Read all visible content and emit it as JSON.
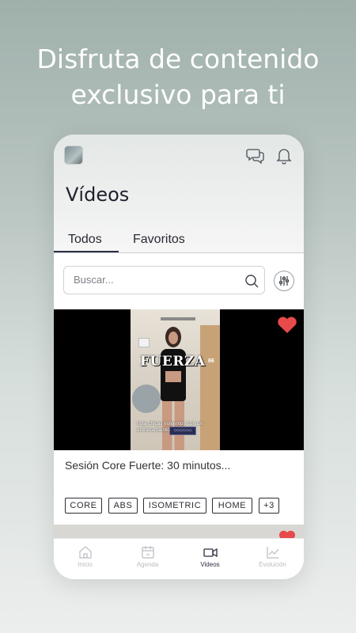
{
  "headline": {
    "line1": "Disfruta de contenido",
    "line2": "exclusivo para ti"
  },
  "screen": {
    "title": "Vídeos",
    "tabs": [
      {
        "label": "Todos",
        "active": true
      },
      {
        "label": "Favoritos",
        "active": false
      }
    ],
    "search": {
      "placeholder": "Buscar...",
      "value": ""
    },
    "video": {
      "title": "Sesión Core Fuerte: 30 minutos...",
      "overlay_word": "FUERZA",
      "overlay_number": "66",
      "caption": "hola chicas volvemos con un entrenamiento de fuerza",
      "badge": "◇◇◇◇◇◇",
      "favorite": true,
      "tags": [
        "CORE",
        "ABS",
        "ISOMETRIC",
        "HOME",
        "+3"
      ]
    },
    "bottom_nav": [
      {
        "label": "Inicio",
        "icon": "home-icon",
        "active": false
      },
      {
        "label": "Agenda",
        "icon": "calendar-icon",
        "active": false
      },
      {
        "label": "Videos",
        "icon": "video-camera-icon",
        "active": true
      },
      {
        "label": "Evolución",
        "icon": "chart-icon",
        "active": false
      }
    ]
  },
  "colors": {
    "accent_dark": "#2a2e45",
    "heart": "#e64a4a",
    "background_top": "#9fb0ab"
  }
}
